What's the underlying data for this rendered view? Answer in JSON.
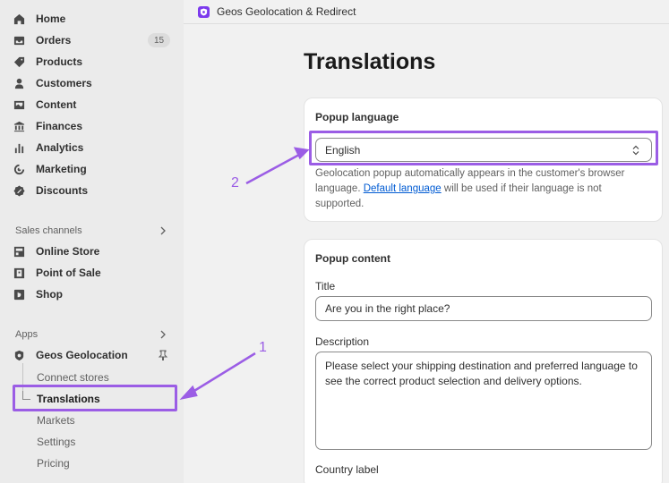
{
  "sidebar": {
    "items": [
      {
        "label": "Home",
        "icon": "home-icon"
      },
      {
        "label": "Orders",
        "icon": "inbox-icon",
        "badge": "15"
      },
      {
        "label": "Products",
        "icon": "tag-icon"
      },
      {
        "label": "Customers",
        "icon": "person-icon"
      },
      {
        "label": "Content",
        "icon": "image-icon"
      },
      {
        "label": "Finances",
        "icon": "bank-icon"
      },
      {
        "label": "Analytics",
        "icon": "bar-chart-icon"
      },
      {
        "label": "Marketing",
        "icon": "target-icon"
      },
      {
        "label": "Discounts",
        "icon": "discount-icon"
      }
    ],
    "sales_channels_label": "Sales channels",
    "sales_channels": [
      {
        "label": "Online Store",
        "icon": "store-icon"
      },
      {
        "label": "Point of Sale",
        "icon": "pos-icon"
      },
      {
        "label": "Shop",
        "icon": "shop-icon"
      }
    ],
    "apps_label": "Apps",
    "app_name": "Geos Geolocation",
    "app_subitems": [
      {
        "label": "Connect stores"
      },
      {
        "label": "Translations"
      },
      {
        "label": "Markets"
      },
      {
        "label": "Settings"
      },
      {
        "label": "Pricing"
      }
    ]
  },
  "topbar": {
    "title": "Geos Geolocation & Redirect"
  },
  "page": {
    "title": "Translations"
  },
  "popup_language": {
    "title": "Popup language",
    "selected": "English",
    "help_before": "Geolocation popup automatically appears in the customer's browser language. ",
    "help_link": "Default language",
    "help_after": " will be used if their language is not supported."
  },
  "popup_content": {
    "title": "Popup content",
    "title_label": "Title",
    "title_value": "Are you in the right place?",
    "description_label": "Description",
    "description_value": "Please select your shipping destination and preferred language to see the correct product selection and delivery options.",
    "country_label": "Country label"
  },
  "annotations": {
    "one": "1",
    "two": "2"
  },
  "colors": {
    "accent": "#9b5de5",
    "link": "#005bd3",
    "app_icon": "#7c3aed"
  }
}
